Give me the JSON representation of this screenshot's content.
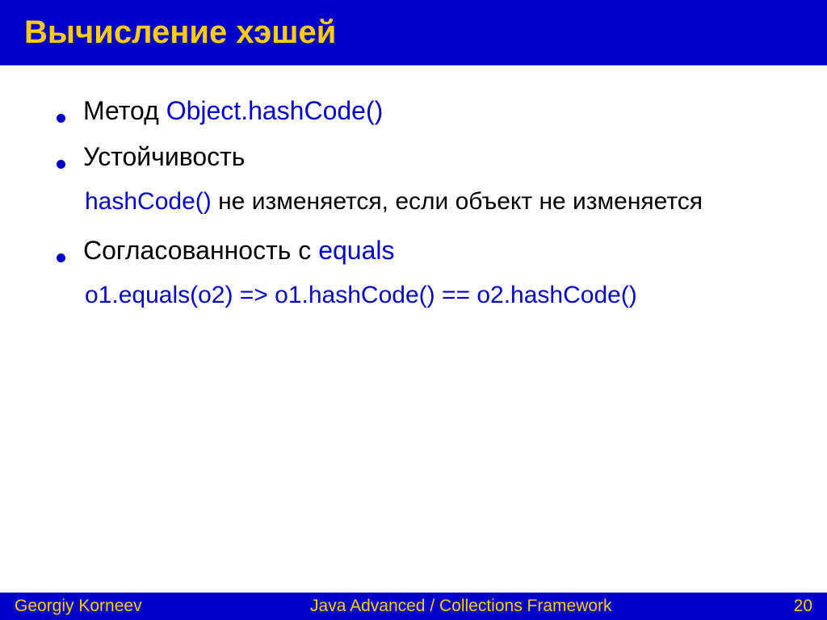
{
  "header": {
    "title": "Вычисление хэшей"
  },
  "content": {
    "bullet1": {
      "black1": "Метод ",
      "blue1": "Object.hashCode()"
    },
    "bullet2": {
      "black1": "Устойчивость"
    },
    "sub2": {
      "blue1": "hashCode()",
      "black1": " не изменяется, если объект не изменяется"
    },
    "bullet3": {
      "black1": "Согласованность с ",
      "blue1": "equals"
    },
    "sub3": {
      "blue1": "o1.equals(o2) => o1.hashCode() == o2.hashCode()"
    }
  },
  "footer": {
    "author": "Georgiy Korneev",
    "course": "Java Advanced / Collections Framework",
    "page": "20"
  }
}
